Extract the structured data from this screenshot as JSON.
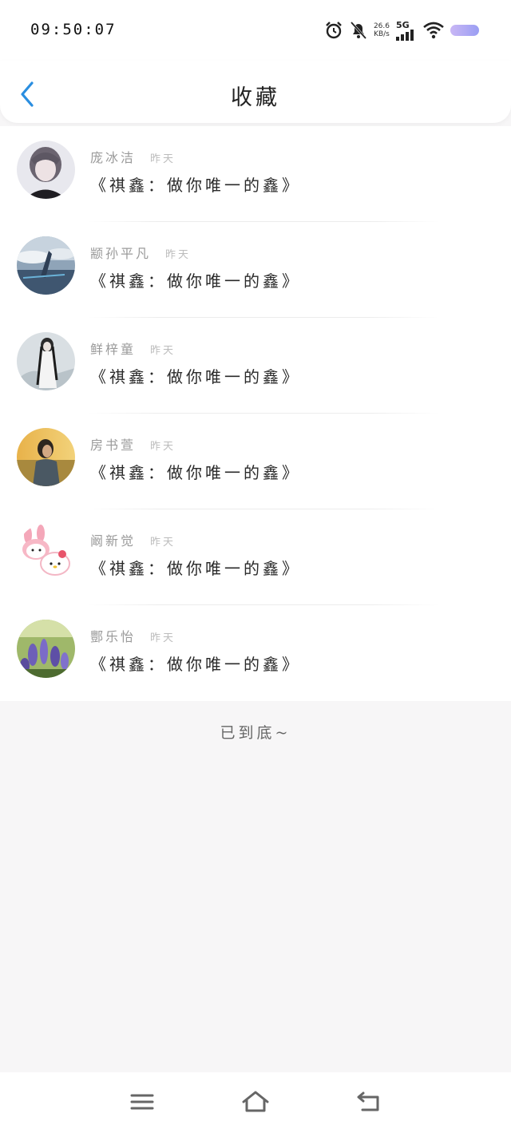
{
  "status_bar": {
    "time": "09:50:07",
    "net_speed_value": "26.6",
    "net_speed_unit": "KB/s",
    "network_type": "5G",
    "icons": [
      "alarm-icon",
      "mute-bell-icon",
      "signal-icon",
      "wifi-icon",
      "battery-icon"
    ]
  },
  "header": {
    "title": "收藏",
    "back_icon": "chevron-left-icon"
  },
  "favorites": [
    {
      "author": "庞冰洁",
      "date": "昨天",
      "title": "《祺鑫：做你唯一的鑫》"
    },
    {
      "author": "颛孙平凡",
      "date": "昨天",
      "title": "《祺鑫：做你唯一的鑫》"
    },
    {
      "author": "鲜梓童",
      "date": "昨天",
      "title": "《祺鑫：做你唯一的鑫》"
    },
    {
      "author": "房书萱",
      "date": "昨天",
      "title": "《祺鑫：做你唯一的鑫》"
    },
    {
      "author": "阚新觉",
      "date": "昨天",
      "title": "《祺鑫：做你唯一的鑫》"
    },
    {
      "author": "酆乐怡",
      "date": "昨天",
      "title": "《祺鑫：做你唯一的鑫》"
    }
  ],
  "end_text": "已到底~",
  "nav_bar": {
    "icons": [
      "menu-icon",
      "home-icon",
      "back-icon"
    ]
  },
  "colors": {
    "accent": "#2a8ee0",
    "background": "#f7f6f7",
    "card": "#ffffff"
  }
}
